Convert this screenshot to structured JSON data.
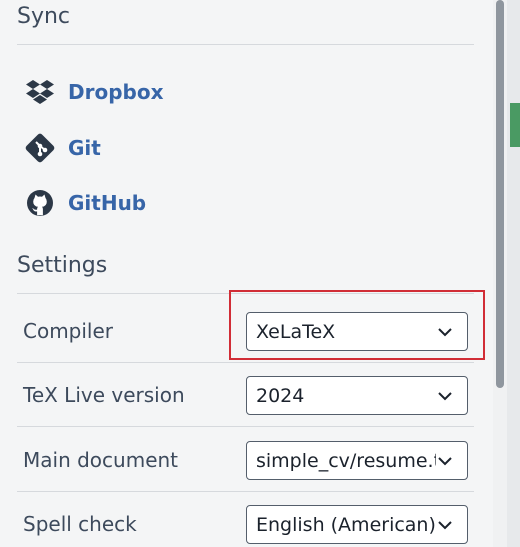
{
  "sync": {
    "title": "Sync",
    "items": [
      {
        "label": "Dropbox",
        "icon": "dropbox-icon"
      },
      {
        "label": "Git",
        "icon": "git-icon"
      },
      {
        "label": "GitHub",
        "icon": "github-icon"
      }
    ]
  },
  "settings": {
    "title": "Settings",
    "rows": [
      {
        "label": "Compiler",
        "value": "XeLaTeX"
      },
      {
        "label": "TeX Live version",
        "value": "2024"
      },
      {
        "label": "Main document",
        "value": "simple_cv/resume.tex"
      },
      {
        "label": "Spell check",
        "value": "English (American)"
      }
    ]
  },
  "colors": {
    "link": "#3765a8",
    "highlight": "#d12d36",
    "panel_bg": "#f4f5f6",
    "accent_green": "#4a9a63"
  }
}
